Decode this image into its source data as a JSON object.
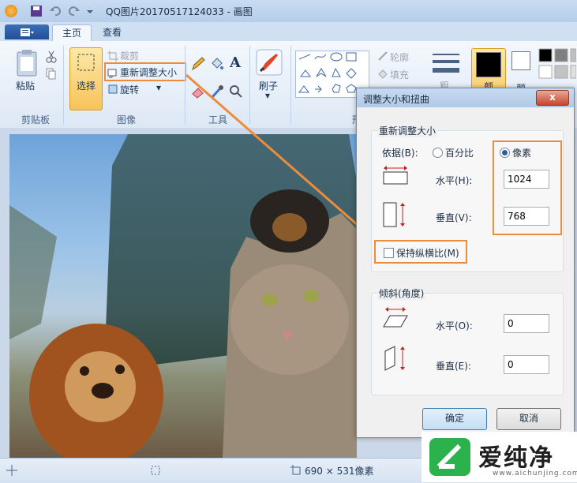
{
  "window": {
    "title": "QQ图片20170517124033 - 画图"
  },
  "tabs": {
    "file_icon": "menu-icon",
    "home": "主页",
    "view": "查看"
  },
  "ribbon": {
    "clipboard": {
      "paste": "粘贴",
      "label": "剪贴板"
    },
    "image": {
      "select": "选择",
      "crop": "裁剪",
      "resize": "重新调整大小",
      "rotate": "旋转",
      "label": "图像"
    },
    "tools": {
      "label": "工具",
      "text_tool": "A"
    },
    "brush": {
      "label": "刷子"
    },
    "shapes": {
      "outline": "轮廓",
      "fill": "填充",
      "label": "形状",
      "size_label": "粗",
      "color1": "颜",
      "color2": "颜"
    }
  },
  "dialog": {
    "title": "调整大小和扭曲",
    "close": "x",
    "resize_group": "重新调整大小",
    "by_label": "依据(B):",
    "percent_option": "百分比",
    "pixels_option": "像素",
    "horizontal_label": "水平(H):",
    "horizontal_value": "1024",
    "vertical_label": "垂直(V):",
    "vertical_value": "768",
    "keep_ratio": "保持纵横比(M)",
    "skew_group": "倾斜(角度)",
    "skew_horizontal_label": "水平(O):",
    "skew_horizontal_value": "0",
    "skew_vertical_label": "垂直(E):",
    "skew_vertical_value": "0",
    "ok": "确定",
    "cancel": "取消"
  },
  "status": {
    "size": "690 × 531像素"
  },
  "watermark": {
    "text": "爱纯净",
    "url": "www.aichunjing.com"
  },
  "colors": {
    "highlight": "#ec8c3d",
    "ribbon": "#f4f8fd",
    "accent": "#2a5fa8"
  }
}
